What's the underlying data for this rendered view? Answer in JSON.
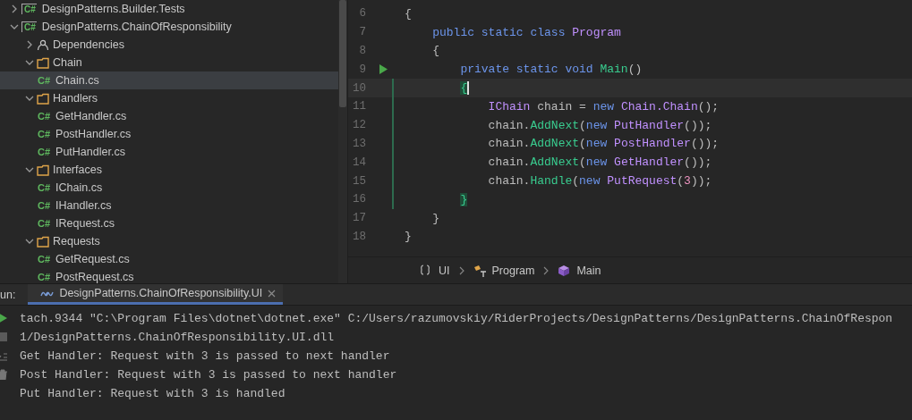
{
  "project_tree": [
    {
      "label": "DesignPatterns.Builder.Tests",
      "kind": "project",
      "icon_label": "C#",
      "expanded": false,
      "selected": false
    },
    {
      "label": "DesignPatterns.ChainOfResponsibility",
      "kind": "project",
      "icon_label": "C#",
      "expanded": true,
      "selected": false,
      "children": [
        {
          "label": "Dependencies",
          "kind": "dependencies",
          "expanded": false,
          "selected": false
        },
        {
          "label": "Chain",
          "kind": "folder",
          "expanded": true,
          "selected": false,
          "children": [
            {
              "label": "Chain.cs",
              "kind": "file",
              "icon_label": "C#",
              "selected": true
            }
          ]
        },
        {
          "label": "Handlers",
          "kind": "folder",
          "expanded": true,
          "selected": false,
          "children": [
            {
              "label": "GetHandler.cs",
              "kind": "file",
              "icon_label": "C#",
              "selected": false
            },
            {
              "label": "PostHandler.cs",
              "kind": "file",
              "icon_label": "C#",
              "selected": false
            },
            {
              "label": "PutHandler.cs",
              "kind": "file",
              "icon_label": "C#",
              "selected": false
            }
          ]
        },
        {
          "label": "Interfaces",
          "kind": "folder",
          "expanded": true,
          "selected": false,
          "children": [
            {
              "label": "IChain.cs",
              "kind": "file",
              "icon_label": "C#",
              "selected": false
            },
            {
              "label": "IHandler.cs",
              "kind": "file",
              "icon_label": "C#",
              "selected": false
            },
            {
              "label": "IRequest.cs",
              "kind": "file",
              "icon_label": "C#",
              "selected": false
            }
          ]
        },
        {
          "label": "Requests",
          "kind": "folder",
          "expanded": true,
          "selected": false,
          "children": [
            {
              "label": "GetRequest.cs",
              "kind": "file",
              "icon_label": "C#",
              "selected": false
            },
            {
              "label": "PostRequest.cs",
              "kind": "file",
              "icon_label": "C#",
              "selected": false
            }
          ]
        }
      ]
    }
  ],
  "editor": {
    "lines": [
      {
        "number": "6",
        "current": false,
        "run_marker": false,
        "modified": false,
        "tokens": [
          {
            "text": "{",
            "kind": "plain"
          }
        ]
      },
      {
        "number": "7",
        "current": false,
        "run_marker": false,
        "modified": false,
        "tokens": [
          {
            "text": "    public static class ",
            "kind": "keyword"
          },
          {
            "text": "Program",
            "kind": "type"
          }
        ]
      },
      {
        "number": "8",
        "current": false,
        "run_marker": false,
        "modified": false,
        "tokens": [
          {
            "text": "    {",
            "kind": "plain"
          }
        ]
      },
      {
        "number": "9",
        "current": false,
        "run_marker": true,
        "modified": false,
        "tokens": [
          {
            "text": "        private static void ",
            "kind": "keyword"
          },
          {
            "text": "Main",
            "kind": "method"
          },
          {
            "text": "()",
            "kind": "plain"
          }
        ]
      },
      {
        "number": "10",
        "current": true,
        "run_marker": false,
        "modified": true,
        "tokens": [
          {
            "text": "        {",
            "kind": "brace_match"
          }
        ]
      },
      {
        "number": "11",
        "current": false,
        "run_marker": false,
        "modified": true,
        "tokens": [
          {
            "text": "            IChain",
            "kind": "type"
          },
          {
            "text": " chain = ",
            "kind": "plain"
          },
          {
            "text": "new ",
            "kind": "keyword"
          },
          {
            "text": "Chain.Chain",
            "kind": "type"
          },
          {
            "text": "();",
            "kind": "plain"
          }
        ]
      },
      {
        "number": "12",
        "current": false,
        "run_marker": false,
        "modified": true,
        "tokens": [
          {
            "text": "            chain.",
            "kind": "plain"
          },
          {
            "text": "AddNext",
            "kind": "method"
          },
          {
            "text": "(",
            "kind": "plain"
          },
          {
            "text": "new ",
            "kind": "keyword"
          },
          {
            "text": "PutHandler",
            "kind": "type"
          },
          {
            "text": "());",
            "kind": "plain"
          }
        ]
      },
      {
        "number": "13",
        "current": false,
        "run_marker": false,
        "modified": true,
        "tokens": [
          {
            "text": "            chain.",
            "kind": "plain"
          },
          {
            "text": "AddNext",
            "kind": "method"
          },
          {
            "text": "(",
            "kind": "plain"
          },
          {
            "text": "new ",
            "kind": "keyword"
          },
          {
            "text": "PostHandler",
            "kind": "type"
          },
          {
            "text": "());",
            "kind": "plain"
          }
        ]
      },
      {
        "number": "14",
        "current": false,
        "run_marker": false,
        "modified": true,
        "tokens": [
          {
            "text": "            chain.",
            "kind": "plain"
          },
          {
            "text": "AddNext",
            "kind": "method"
          },
          {
            "text": "(",
            "kind": "plain"
          },
          {
            "text": "new ",
            "kind": "keyword"
          },
          {
            "text": "GetHandler",
            "kind": "type"
          },
          {
            "text": "());",
            "kind": "plain"
          }
        ]
      },
      {
        "number": "15",
        "current": false,
        "run_marker": false,
        "modified": true,
        "tokens": [
          {
            "text": "            chain.",
            "kind": "plain"
          },
          {
            "text": "Handle",
            "kind": "method"
          },
          {
            "text": "(",
            "kind": "plain"
          },
          {
            "text": "new ",
            "kind": "keyword"
          },
          {
            "text": "PutRequest",
            "kind": "type"
          },
          {
            "text": "(",
            "kind": "plain"
          },
          {
            "text": "3",
            "kind": "number"
          },
          {
            "text": "));",
            "kind": "plain"
          }
        ]
      },
      {
        "number": "16",
        "current": false,
        "run_marker": false,
        "modified": true,
        "tokens": [
          {
            "text": "        }",
            "kind": "brace_match"
          }
        ]
      },
      {
        "number": "17",
        "current": false,
        "run_marker": false,
        "modified": false,
        "tokens": [
          {
            "text": "    }",
            "kind": "plain"
          }
        ]
      },
      {
        "number": "18",
        "current": false,
        "run_marker": false,
        "modified": false,
        "tokens": [
          {
            "text": "}",
            "kind": "plain"
          }
        ]
      }
    ]
  },
  "breadcrumb": [
    {
      "label": "UI",
      "kind": "namespace"
    },
    {
      "label": "Program",
      "kind": "class"
    },
    {
      "label": "Main",
      "kind": "method"
    }
  ],
  "run_panel": {
    "label": "un:",
    "tab": {
      "label": "DesignPatterns.ChainOfResponsibility.UI",
      "selected": true
    },
    "console": [
      "tach.9344 \"C:\\Program Files\\dotnet\\dotnet.exe\" C:/Users/razumovskiy/RiderProjects/DesignPatterns/DesignPatterns.ChainOfRespon",
      "1/DesignPatterns.ChainOfResponsibility.UI.dll",
      "Get Handler: Request with 3 is passed to next handler",
      "Post Handler: Request with 3 is passed to next handler",
      "Put Handler: Request with 3 is handled"
    ]
  }
}
